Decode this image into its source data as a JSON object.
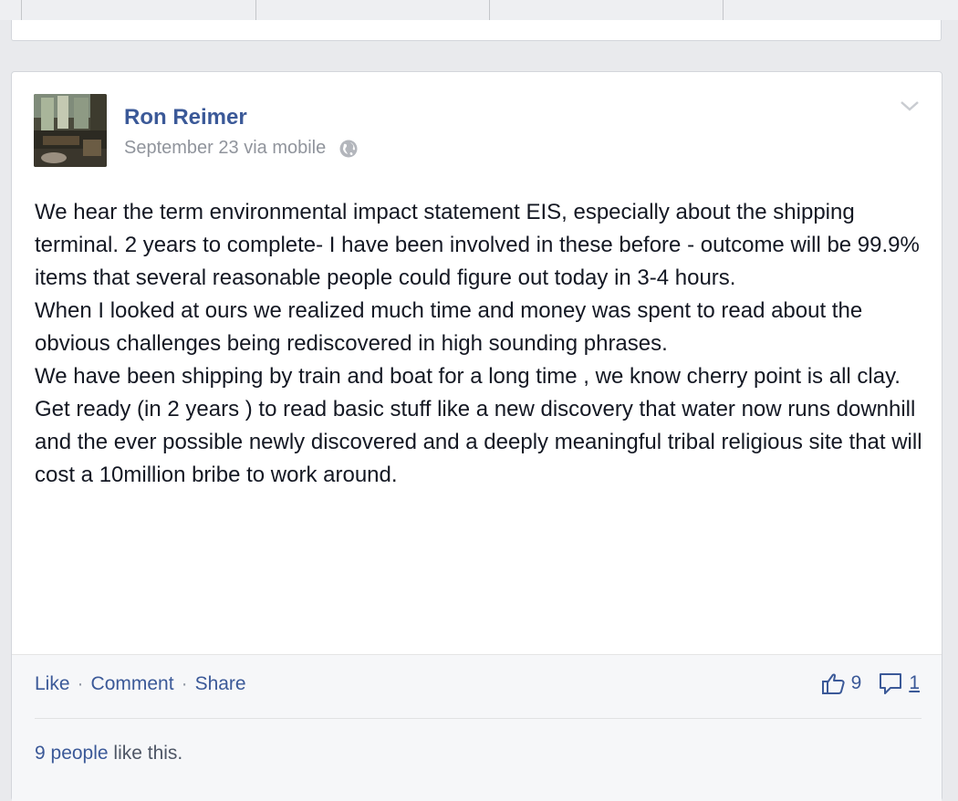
{
  "post": {
    "author": "Ron Reimer",
    "meta": "September 23 via mobile",
    "paragraphs": [
      "We hear the term environmental impact statement EIS, especially about the shipping terminal. 2 years to complete- I have been involved in these before - outcome will be 99.9% items that several reasonable people could figure out today in 3-4 hours.",
      "When I looked at ours we realized much time and money was spent to read about the obvious challenges being rediscovered in high sounding phrases.",
      "We have been shipping by train and boat for a long time , we know cherry point is all clay.",
      "Get ready (in 2 years ) to read basic stuff like a new discovery that water now runs downhill and the ever possible newly discovered and a deeply meaningful tribal religious site that will cost a 10million bribe to work around."
    ],
    "actions": {
      "like": "Like",
      "comment": "Comment",
      "share": "Share",
      "separator": "·"
    },
    "like_count": "9",
    "comment_count": "1",
    "likes_summary": {
      "people": "9 people",
      "rest": " like this."
    },
    "icons": {
      "privacy": "globe-icon",
      "menu": "chevron-down-icon",
      "like": "thumbs-up-icon",
      "comment": "comment-bubble-icon"
    },
    "colors": {
      "link": "#3b5998",
      "text": "#141823",
      "muted": "#90949c",
      "background": "#e9eaed"
    }
  }
}
